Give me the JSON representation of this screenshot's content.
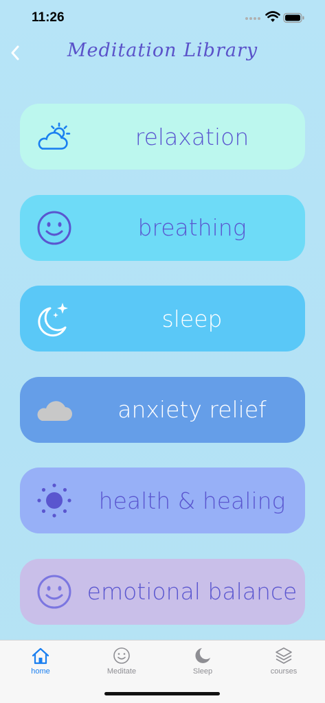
{
  "status_bar": {
    "time": "11:26"
  },
  "header": {
    "title": "Meditation Library",
    "back_icon": "chevron-left-icon"
  },
  "categories": [
    {
      "label": "relaxation",
      "icon": "sun-cloud-icon",
      "bg": "#bcf7ee",
      "text_color": "#5a56cf",
      "icon_color": "#1a7ff0"
    },
    {
      "label": "breathing",
      "icon": "smiley-face-icon",
      "bg": "#6edbf7",
      "text_color": "#5a56cf",
      "icon_color": "#5a56cf"
    },
    {
      "label": "sleep",
      "icon": "moon-stars-icon",
      "bg": "#5ac8f7",
      "text_color": "#ffffff",
      "icon_color": "#ffffff"
    },
    {
      "label": "anxiety relief",
      "icon": "cloud-icon",
      "bg": "#659ee8",
      "text_color": "#ffffff",
      "icon_color": "#c8c8c8"
    },
    {
      "label": "health & healing",
      "icon": "sun-icon",
      "bg": "#97b0f7",
      "text_color": "#5a56cf",
      "icon_color": "#5a56cf"
    },
    {
      "label": "emotional balance",
      "icon": "smiley-face-icon",
      "bg": "#c9bfe9",
      "text_color": "#5a56cf",
      "icon_color": "#7b76e0"
    }
  ],
  "tab_bar": {
    "tabs": [
      {
        "label": "home",
        "icon": "house-icon",
        "active": true
      },
      {
        "label": "Meditate",
        "icon": "smiley-face-icon",
        "active": false
      },
      {
        "label": "Sleep",
        "icon": "moon-icon",
        "active": false
      },
      {
        "label": "courses",
        "icon": "layers-icon",
        "active": false
      }
    ],
    "active_color": "#1a7ff0",
    "inactive_color": "#8e8e93"
  }
}
